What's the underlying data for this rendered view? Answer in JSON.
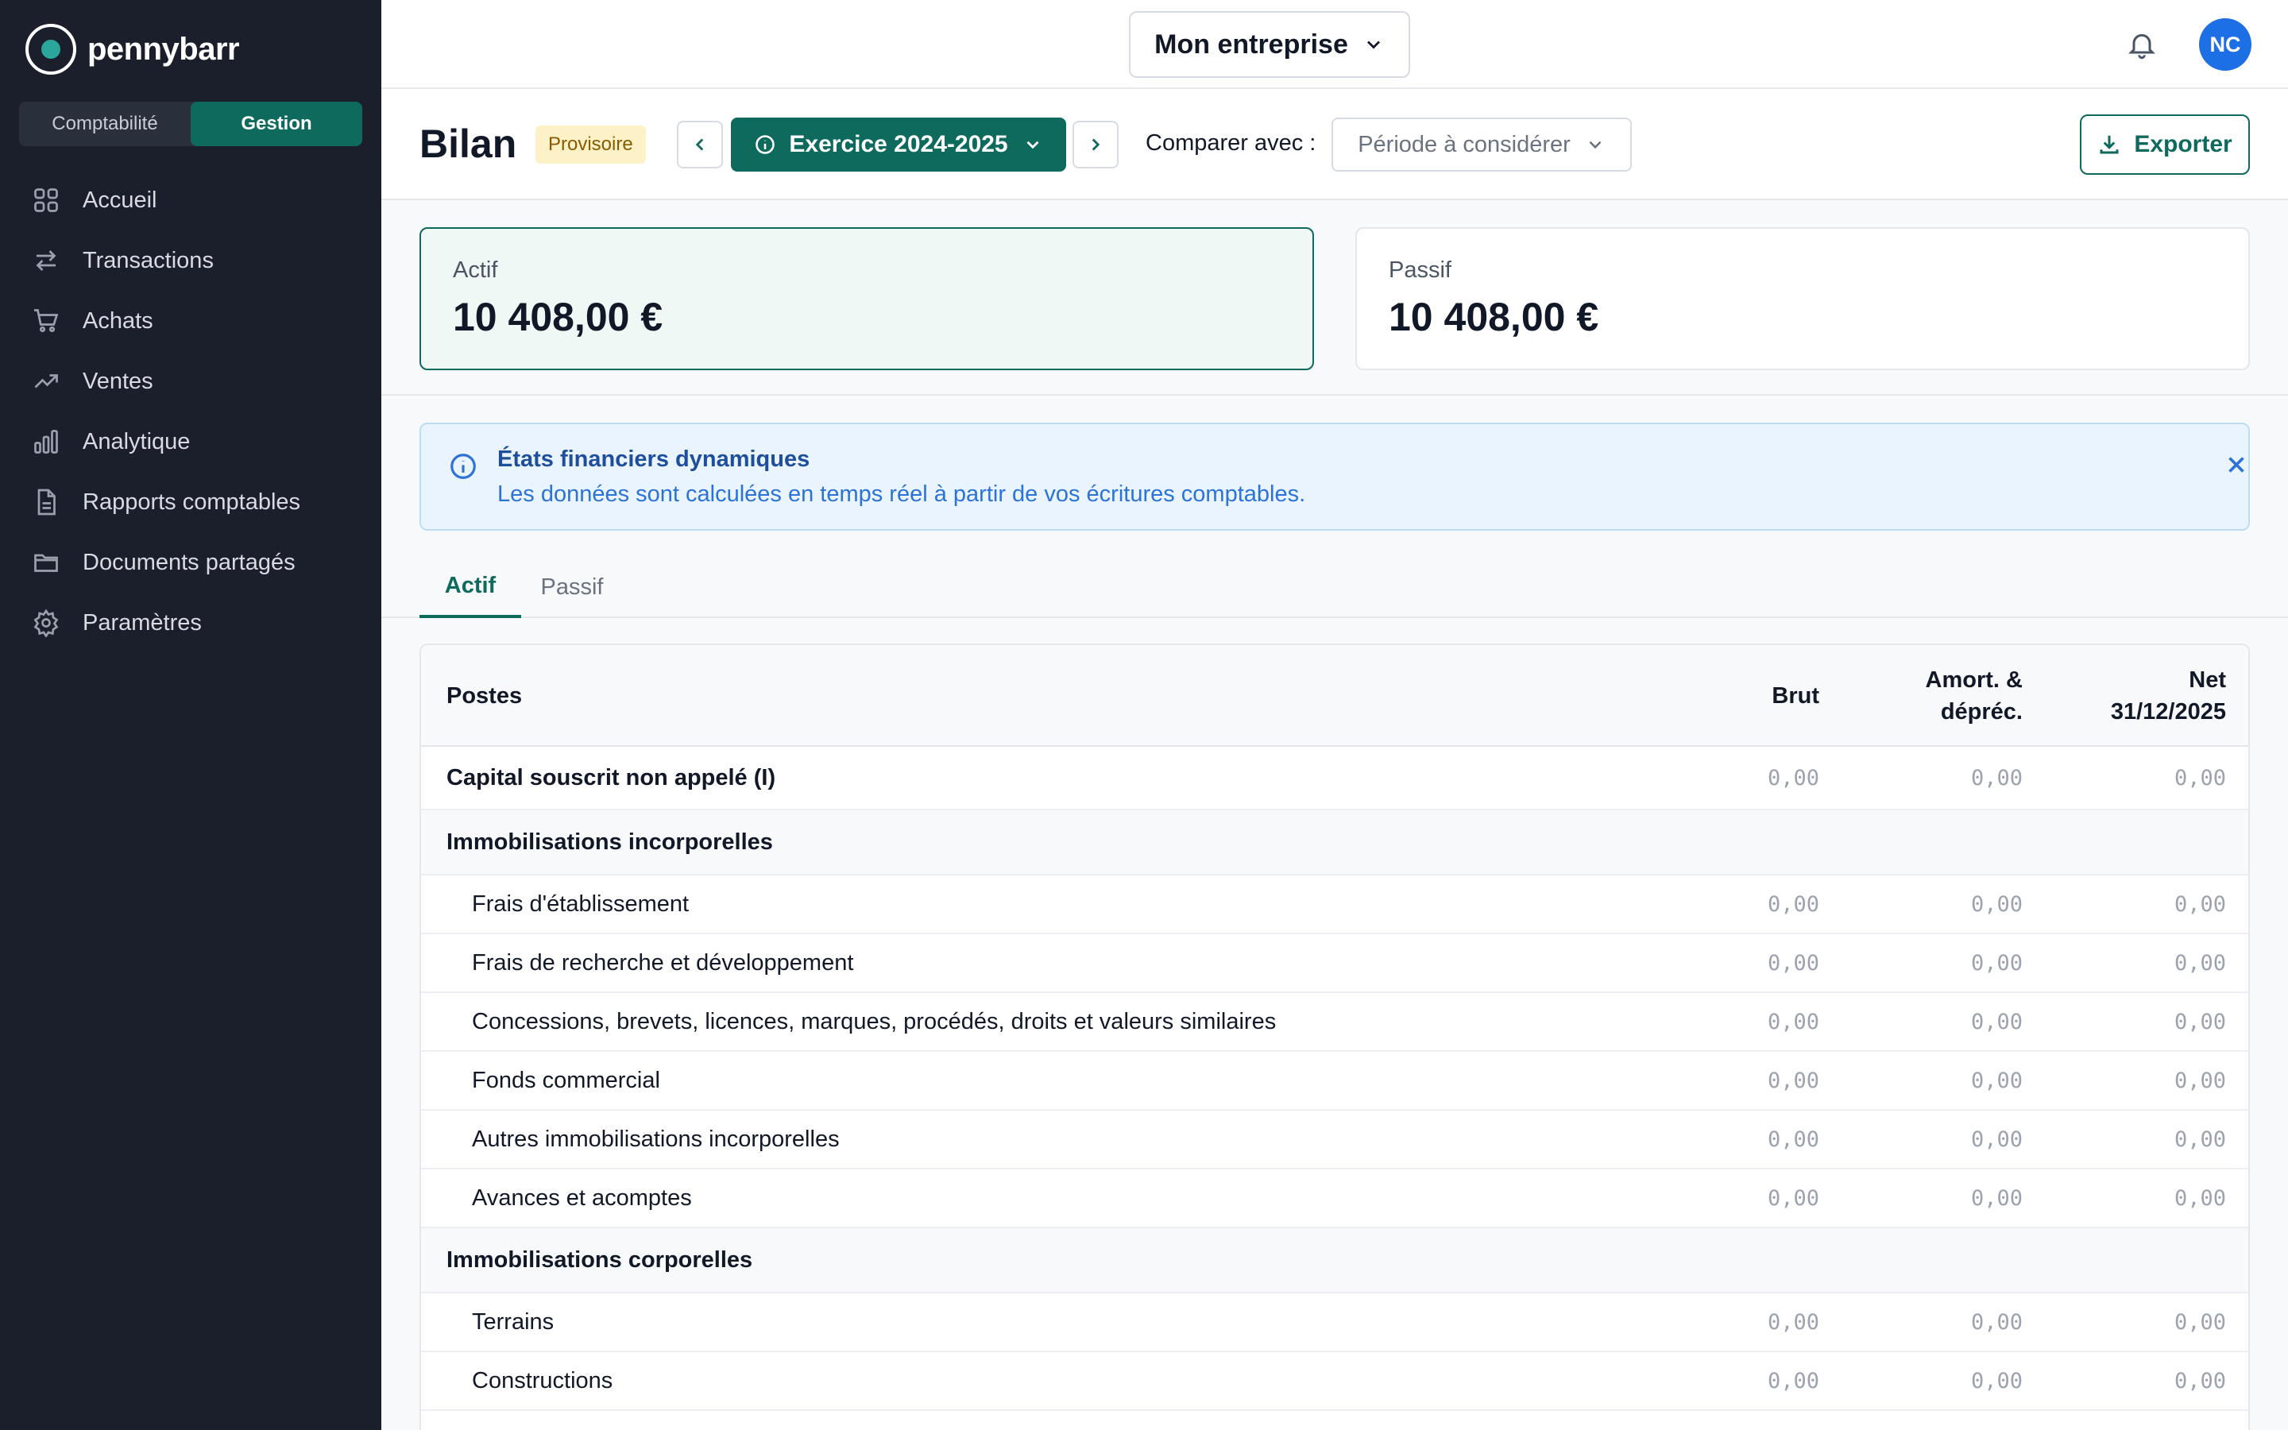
{
  "brand": {
    "name": "pennybarr"
  },
  "mode_switch": {
    "items": [
      "Comptabilité",
      "Gestion"
    ],
    "active": "Gestion"
  },
  "sidebar": {
    "items": [
      {
        "label": "Accueil",
        "icon": "grid-icon"
      },
      {
        "label": "Transactions",
        "icon": "arrows-icon"
      },
      {
        "label": "Achats",
        "icon": "cart-icon"
      },
      {
        "label": "Ventes",
        "icon": "trend-up-icon"
      },
      {
        "label": "Analytique",
        "icon": "bar-chart-icon"
      },
      {
        "label": "Rapports comptables",
        "icon": "document-icon"
      },
      {
        "label": "Documents partagés",
        "icon": "folder-icon"
      },
      {
        "label": "Paramètres",
        "icon": "gear-icon"
      }
    ]
  },
  "topbar": {
    "company": "Mon entreprise",
    "avatar_initials": "NC"
  },
  "header": {
    "title": "Bilan",
    "status_badge": "Provisoire",
    "exercise": "Exercice 2024-2025",
    "compare_label": "Comparer avec :",
    "compare_placeholder": "Période à considérer",
    "export_label": "Exporter"
  },
  "summary": {
    "actif": {
      "label": "Actif",
      "value": "10 408,00 €"
    },
    "passif": {
      "label": "Passif",
      "value": "10 408,00 €"
    }
  },
  "info_banner": {
    "title": "États financiers dynamiques",
    "text": "Les données sont calculées en temps réel à partir de vos écritures comptables."
  },
  "tabs": [
    {
      "label": "Actif"
    },
    {
      "label": "Passif"
    }
  ],
  "table": {
    "headers": {
      "postes": "Postes",
      "brut": "Brut",
      "amort_line1": "Amort. &",
      "amort_line2": "dépréc.",
      "net_line1": "Net",
      "net_line2": "31/12/2025"
    },
    "rows": [
      {
        "label": "Capital souscrit non appelé (I)",
        "kind": "top",
        "brut": "0,00",
        "amort": "0,00",
        "net": "0,00"
      },
      {
        "label": "Immobilisations incorporelles",
        "kind": "section"
      },
      {
        "label": "Frais d'établissement",
        "kind": "sub",
        "brut": "0,00",
        "amort": "0,00",
        "net": "0,00"
      },
      {
        "label": "Frais de recherche et développement",
        "kind": "sub",
        "brut": "0,00",
        "amort": "0,00",
        "net": "0,00"
      },
      {
        "label": "Concessions, brevets, licences, marques, procédés, droits et valeurs similaires",
        "kind": "sub",
        "brut": "0,00",
        "amort": "0,00",
        "net": "0,00"
      },
      {
        "label": "Fonds commercial",
        "kind": "sub",
        "brut": "0,00",
        "amort": "0,00",
        "net": "0,00"
      },
      {
        "label": "Autres immobilisations incorporelles",
        "kind": "sub",
        "brut": "0,00",
        "amort": "0,00",
        "net": "0,00"
      },
      {
        "label": "Avances et acomptes",
        "kind": "sub",
        "brut": "0,00",
        "amort": "0,00",
        "net": "0,00"
      },
      {
        "label": "Immobilisations corporelles",
        "kind": "section"
      },
      {
        "label": "Terrains",
        "kind": "sub",
        "brut": "0,00",
        "amort": "0,00",
        "net": "0,00"
      },
      {
        "label": "Constructions",
        "kind": "sub",
        "brut": "0,00",
        "amort": "0,00",
        "net": "0,00"
      }
    ]
  }
}
